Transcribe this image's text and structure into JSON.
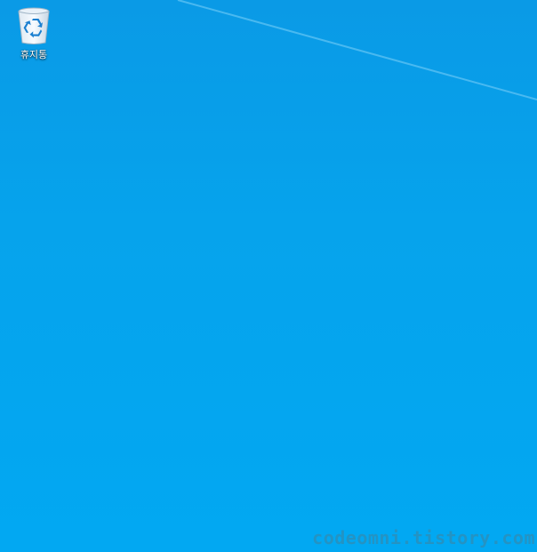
{
  "desktop": {
    "background_color": "#06a3ec",
    "icons": [
      {
        "label": "휴지통",
        "icon": "recycle-bin-icon"
      }
    ]
  },
  "watermark": {
    "text": "codeomni.tistory.com",
    "color": "#2d8fb8"
  }
}
